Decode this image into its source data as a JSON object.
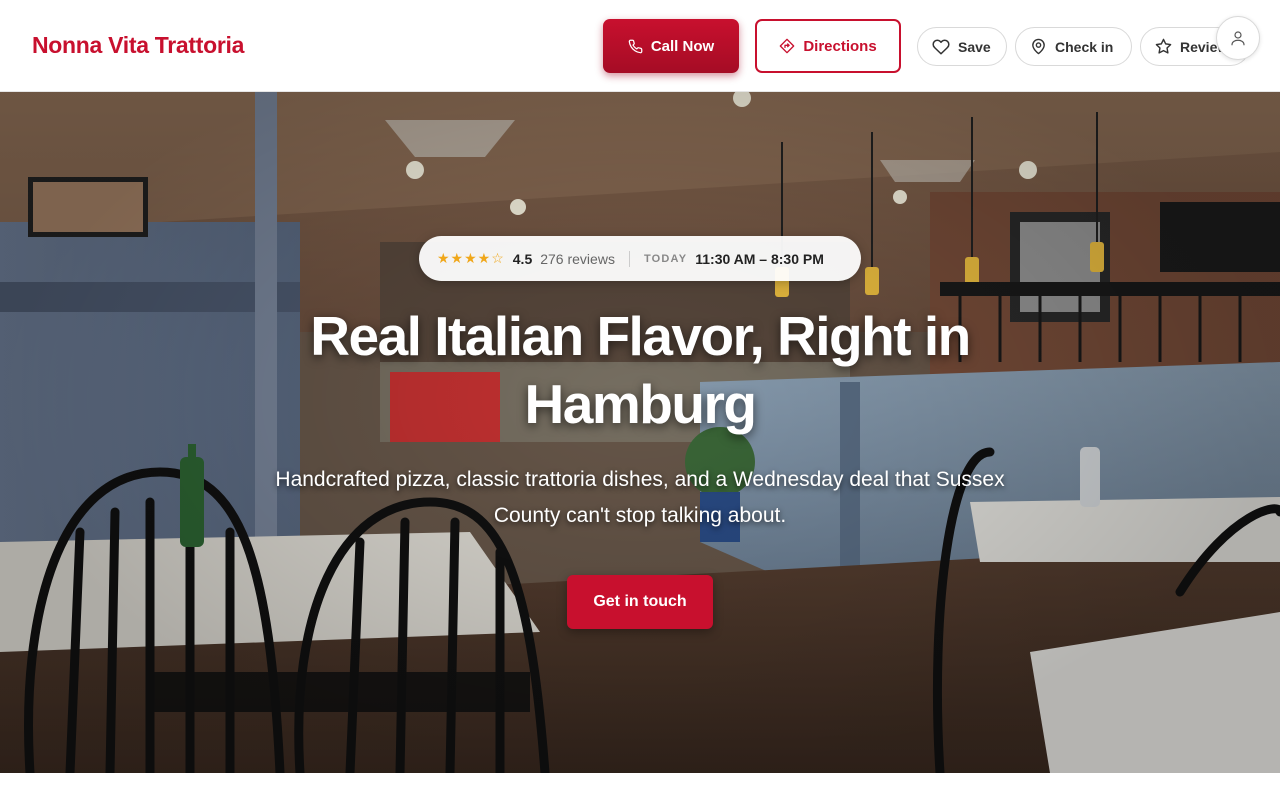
{
  "header": {
    "brand": "Nonna Vita Trattoria",
    "call_label": "Call Now",
    "directions_label": "Directions",
    "save_label": "Save",
    "checkin_label": "Check in",
    "review_label": "Review",
    "icons": {
      "call": "phone-icon",
      "directions": "directions-icon",
      "save": "heart-icon",
      "checkin": "map-pin-icon",
      "review": "star-icon",
      "account": "user-icon"
    }
  },
  "hero": {
    "rating": {
      "stars": "★★★★☆",
      "score": "4.5",
      "reviews": "276 reviews",
      "today_label": "TODAY",
      "hours": "11:30 AM – 8:30 PM"
    },
    "title": "Real Italian Flavor, Right in Hamburg",
    "subtitle": "Handcrafted pizza, classic trattoria dishes, and a Wednesday deal that Sussex County can't stop talking about.",
    "cta_label": "Get in touch"
  },
  "colors": {
    "brand": "#c8102e",
    "star": "#f0a71a"
  }
}
